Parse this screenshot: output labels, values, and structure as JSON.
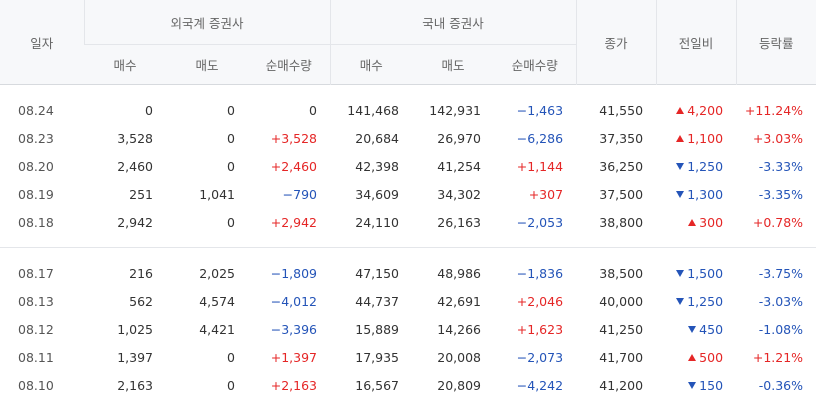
{
  "header": {
    "date": "일자",
    "foreign_group": "외국계 증권사",
    "domestic_group": "국내 증권사",
    "close": "종가",
    "change": "전일비",
    "rate": "등락률",
    "sub": [
      "매수",
      "매도",
      "순매수량",
      "매수",
      "매도",
      "순매수량"
    ]
  },
  "colors": {
    "up": "#e52626",
    "down": "#2454b8"
  },
  "rows": [
    {
      "date": "08.24",
      "f_buy": "0",
      "f_sell": "0",
      "f_net": "0",
      "f_net_dir": "neu",
      "d_buy": "141,468",
      "d_sell": "142,931",
      "d_net": "−1,463",
      "d_net_dir": "down",
      "close": "41,550",
      "chg": "4,200",
      "chg_dir": "up",
      "chg_icon": "triangle-up-icon",
      "rate": "+11.24%",
      "rate_dir": "up"
    },
    {
      "date": "08.23",
      "f_buy": "3,528",
      "f_sell": "0",
      "f_net": "+3,528",
      "f_net_dir": "up",
      "d_buy": "20,684",
      "d_sell": "26,970",
      "d_net": "−6,286",
      "d_net_dir": "down",
      "close": "37,350",
      "chg": "1,100",
      "chg_dir": "up",
      "chg_icon": "triangle-up-icon",
      "rate": "+3.03%",
      "rate_dir": "up"
    },
    {
      "date": "08.20",
      "f_buy": "2,460",
      "f_sell": "0",
      "f_net": "+2,460",
      "f_net_dir": "up",
      "d_buy": "42,398",
      "d_sell": "41,254",
      "d_net": "+1,144",
      "d_net_dir": "up",
      "close": "36,250",
      "chg": "1,250",
      "chg_dir": "down",
      "chg_icon": "triangle-down-icon",
      "rate": "-3.33%",
      "rate_dir": "down"
    },
    {
      "date": "08.19",
      "f_buy": "251",
      "f_sell": "1,041",
      "f_net": "−790",
      "f_net_dir": "down",
      "d_buy": "34,609",
      "d_sell": "34,302",
      "d_net": "+307",
      "d_net_dir": "up",
      "close": "37,500",
      "chg": "1,300",
      "chg_dir": "down",
      "chg_icon": "triangle-down-icon",
      "rate": "-3.35%",
      "rate_dir": "down"
    },
    {
      "date": "08.18",
      "f_buy": "2,942",
      "f_sell": "0",
      "f_net": "+2,942",
      "f_net_dir": "up",
      "d_buy": "24,110",
      "d_sell": "26,163",
      "d_net": "−2,053",
      "d_net_dir": "down",
      "close": "38,800",
      "chg": "300",
      "chg_dir": "up",
      "chg_icon": "triangle-up-icon",
      "rate": "+0.78%",
      "rate_dir": "up"
    },
    {
      "date": "08.17",
      "f_buy": "216",
      "f_sell": "2,025",
      "f_net": "−1,809",
      "f_net_dir": "down",
      "d_buy": "47,150",
      "d_sell": "48,986",
      "d_net": "−1,836",
      "d_net_dir": "down",
      "close": "38,500",
      "chg": "1,500",
      "chg_dir": "down",
      "chg_icon": "triangle-down-icon",
      "rate": "-3.75%",
      "rate_dir": "down"
    },
    {
      "date": "08.13",
      "f_buy": "562",
      "f_sell": "4,574",
      "f_net": "−4,012",
      "f_net_dir": "down",
      "d_buy": "44,737",
      "d_sell": "42,691",
      "d_net": "+2,046",
      "d_net_dir": "up",
      "close": "40,000",
      "chg": "1,250",
      "chg_dir": "down",
      "chg_icon": "triangle-down-icon",
      "rate": "-3.03%",
      "rate_dir": "down"
    },
    {
      "date": "08.12",
      "f_buy": "1,025",
      "f_sell": "4,421",
      "f_net": "−3,396",
      "f_net_dir": "down",
      "d_buy": "15,889",
      "d_sell": "14,266",
      "d_net": "+1,623",
      "d_net_dir": "up",
      "close": "41,250",
      "chg": "450",
      "chg_dir": "down",
      "chg_icon": "triangle-down-icon",
      "rate": "-1.08%",
      "rate_dir": "down"
    },
    {
      "date": "08.11",
      "f_buy": "1,397",
      "f_sell": "0",
      "f_net": "+1,397",
      "f_net_dir": "up",
      "d_buy": "17,935",
      "d_sell": "20,008",
      "d_net": "−2,073",
      "d_net_dir": "down",
      "close": "41,700",
      "chg": "500",
      "chg_dir": "up",
      "chg_icon": "triangle-up-icon",
      "rate": "+1.21%",
      "rate_dir": "up"
    },
    {
      "date": "08.10",
      "f_buy": "2,163",
      "f_sell": "0",
      "f_net": "+2,163",
      "f_net_dir": "up",
      "d_buy": "16,567",
      "d_sell": "20,809",
      "d_net": "−4,242",
      "d_net_dir": "down",
      "close": "41,200",
      "chg": "150",
      "chg_dir": "down",
      "chg_icon": "triangle-down-icon",
      "rate": "-0.36%",
      "rate_dir": "down"
    }
  ]
}
